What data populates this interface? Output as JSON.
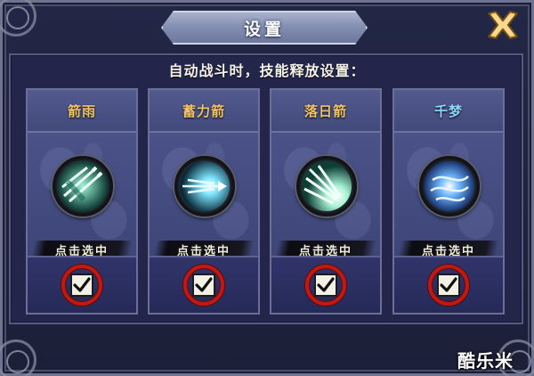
{
  "dialog": {
    "title": "设置",
    "instruction": "自动战斗时，技能释放设置：",
    "close_icon": "close-x-icon"
  },
  "skills": [
    {
      "name": "箭雨",
      "name_color": "#f2c46a",
      "icon": "arrow-rain-skill-icon",
      "select_label": "点击选中",
      "checked": true
    },
    {
      "name": "蓄力箭",
      "name_color": "#f2c46a",
      "icon": "charged-arrow-skill-icon",
      "select_label": "点击选中",
      "checked": true
    },
    {
      "name": "落日箭",
      "name_color": "#f2c46a",
      "icon": "sunset-arrow-skill-icon",
      "select_label": "点击选中",
      "checked": true
    },
    {
      "name": "千梦",
      "name_color": "#8fd6ff",
      "icon": "thousand-dreams-skill-icon",
      "select_label": "点击选中",
      "checked": true
    }
  ],
  "watermark": "酷乐米",
  "colors": {
    "accent_gold": "#f2c46a",
    "accent_blue": "#8fd6ff",
    "check_ring": "#c21812"
  }
}
